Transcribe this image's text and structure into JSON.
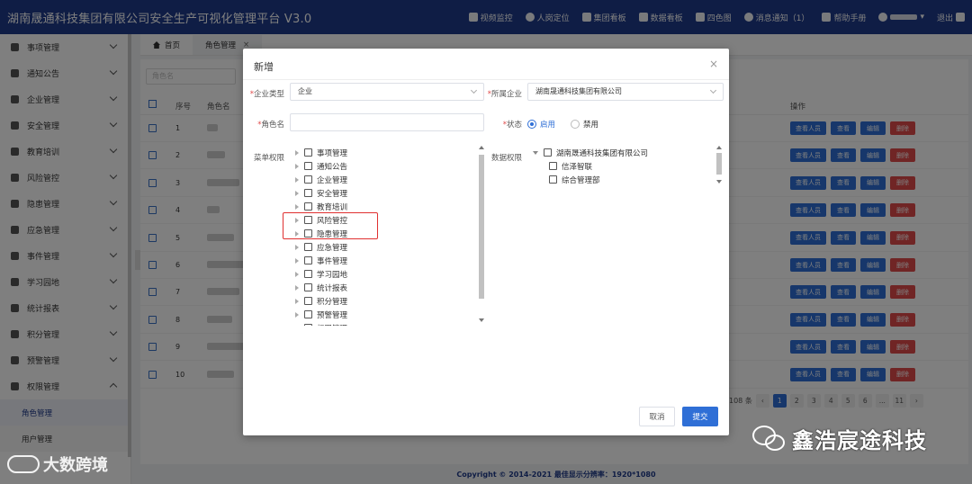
{
  "app_title": "湖南晟通科技集团有限公司安全生产可视化管理平台  V3.0",
  "topnav": {
    "video": "视频监控",
    "locate": "人岗定位",
    "group_board": "集团看板",
    "data_board": "数据看板",
    "four_color": "四色图",
    "notify": "消息通知（1）",
    "help": "帮助手册",
    "logout": "退出"
  },
  "sidebar": {
    "items": [
      {
        "label": "事项管理"
      },
      {
        "label": "通知公告"
      },
      {
        "label": "企业管理"
      },
      {
        "label": "安全管理"
      },
      {
        "label": "教育培训"
      },
      {
        "label": "风险管控"
      },
      {
        "label": "隐患管理"
      },
      {
        "label": "应急管理"
      },
      {
        "label": "事件管理"
      },
      {
        "label": "学习园地"
      },
      {
        "label": "统计报表"
      },
      {
        "label": "积分管理"
      },
      {
        "label": "预警管理"
      },
      {
        "label": "权限管理"
      }
    ],
    "sub_items": [
      {
        "label": "角色管理"
      },
      {
        "label": "用户管理"
      }
    ]
  },
  "tabs": [
    {
      "label": "首页"
    },
    {
      "label": "角色管理",
      "close": "×"
    }
  ],
  "content": {
    "search_placeholder": "角色名",
    "headers": {
      "index": "序号",
      "name": "角色名",
      "ops": "操作"
    },
    "rows": [
      {
        "num": "1"
      },
      {
        "num": "2"
      },
      {
        "num": "3"
      },
      {
        "num": "4"
      },
      {
        "num": "5"
      },
      {
        "num": "6"
      },
      {
        "num": "7"
      },
      {
        "num": "8"
      },
      {
        "num": "9"
      },
      {
        "num": "10"
      }
    ],
    "row_buttons": {
      "view_users": "查看人员",
      "view": "查看",
      "edit": "编辑",
      "delete": "删除"
    },
    "pager": {
      "total": "108 条",
      "pages": [
        "1",
        "2",
        "3",
        "4",
        "5",
        "6",
        "...",
        "11"
      ],
      "prev": "‹",
      "next": "›"
    }
  },
  "footer": "Copyright © 2014-2021  最佳显示分辨率：1920*1080",
  "dialog": {
    "title": "新增",
    "close": "×",
    "enterprise_type_label": "企业类型",
    "enterprise_type_value": "企业",
    "company_label": "所属企业",
    "company_value": "湖南晟通科技集团有限公司",
    "role_name_label": "角色名",
    "status_label": "状态",
    "status_enabled": "启用",
    "status_disabled": "禁用",
    "menu_perm_label": "菜单权限",
    "menu_tree": [
      "事项管理",
      "通知公告",
      "企业管理",
      "安全管理",
      "教育培训",
      "风险管控",
      "隐患管理",
      "应急管理",
      "事件管理",
      "学习园地",
      "统计报表",
      "积分管理",
      "预警管理",
      "权限管理"
    ],
    "data_perm_label": "数据权限",
    "data_tree": {
      "root": "湖南晟通科技集团有限公司",
      "children": [
        "信泽智联",
        "综合管理部"
      ]
    },
    "cancel": "取消",
    "submit": "提交",
    "required_mark": "*"
  },
  "watermarks": {
    "left": "大数跨境",
    "right": "鑫浩宸途科技"
  }
}
